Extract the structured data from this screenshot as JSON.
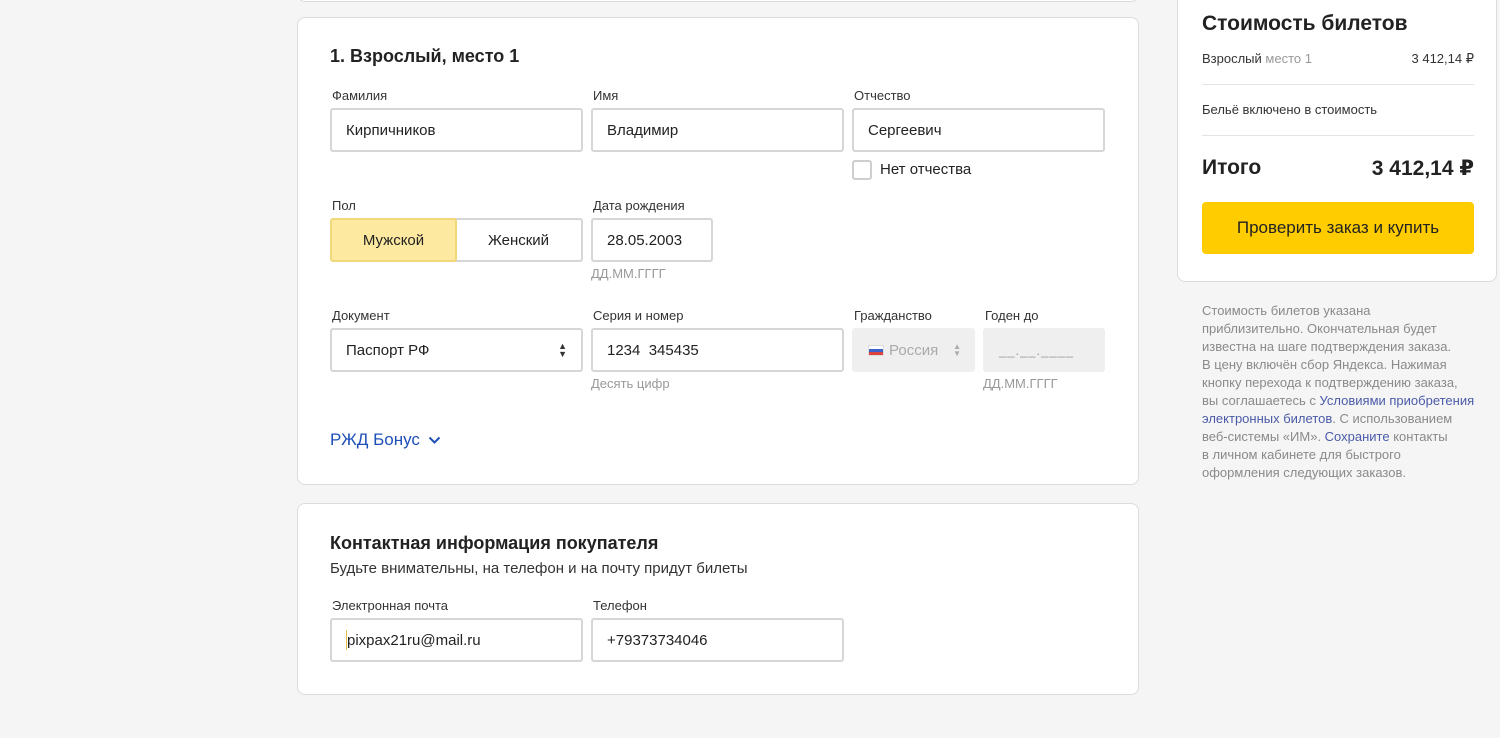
{
  "passenger": {
    "title": "1. Взрослый, место 1",
    "last_name_label": "Фамилия",
    "last_name": "Кирпичников",
    "first_name_label": "Имя",
    "first_name": "Владимир",
    "patronymic_label": "Отчество",
    "patronymic": "Сергеевич",
    "no_patronymic_label": "Нет отчества",
    "gender_label": "Пол",
    "gender_male": "Мужской",
    "gender_female": "Женский",
    "gender_selected": "Мужской",
    "birth_label": "Дата рождения",
    "birth_date": "28.05.2003",
    "birth_hint": "ДД.ММ.ГГГГ",
    "document_label": "Документ",
    "document_value": "Паспорт РФ",
    "series_label": "Серия и номер",
    "series_value": "1234  345435",
    "series_hint": "Десять цифр",
    "citizenship_label": "Гражданство",
    "citizenship_value": "Россия",
    "valid_until_label": "Годен до",
    "valid_until_placeholder": "__.__.____",
    "valid_until_hint": "ДД.ММ.ГГГГ",
    "bonus_link": "РЖД Бонус"
  },
  "contact": {
    "title": "Контактная информация покупателя",
    "subtitle": "Будьте внимательны, на телефон и на почту придут билеты",
    "email_label": "Электронная почта",
    "email": "pixpax21ru@mail.ru",
    "phone_label": "Телефон",
    "phone": "+79373734046"
  },
  "summary": {
    "title": "Стоимость билетов",
    "line_prefix": "Взрослый",
    "line_suffix": "место 1",
    "line_price": "3 412,14 ₽",
    "linen_note": "Бельё включено в стоимость",
    "total_label": "Итого",
    "total_value": "3 412,14 ₽",
    "buy_button": "Проверить заказ и купить"
  },
  "disclaimer": {
    "line1": "Стоимость билетов указана",
    "line2": "приблизительно. Окончательная будет",
    "line3": "известна на шаге подтверждения заказа.",
    "line4": "В цену включён сбор Яндекса. Нажимая",
    "line5": "кнопку перехода к подтверждению заказа,",
    "line6_pre": "вы соглашаетесь с ",
    "line6_link": "Условиями приобретения",
    "line7_link": "электронных билетов",
    "line7_post": ". С использованием",
    "line8_pre": "веб-системы «ИМ». ",
    "line8_link": "Сохраните",
    "line8_post": " контакты",
    "line9": "в личном кабинете для быстрого",
    "line10": "оформления следующих заказов."
  },
  "colors": {
    "accent_yellow": "#ffcc00",
    "selected_segment": "#fdeaa0",
    "link_blue": "#1e4fb8"
  }
}
